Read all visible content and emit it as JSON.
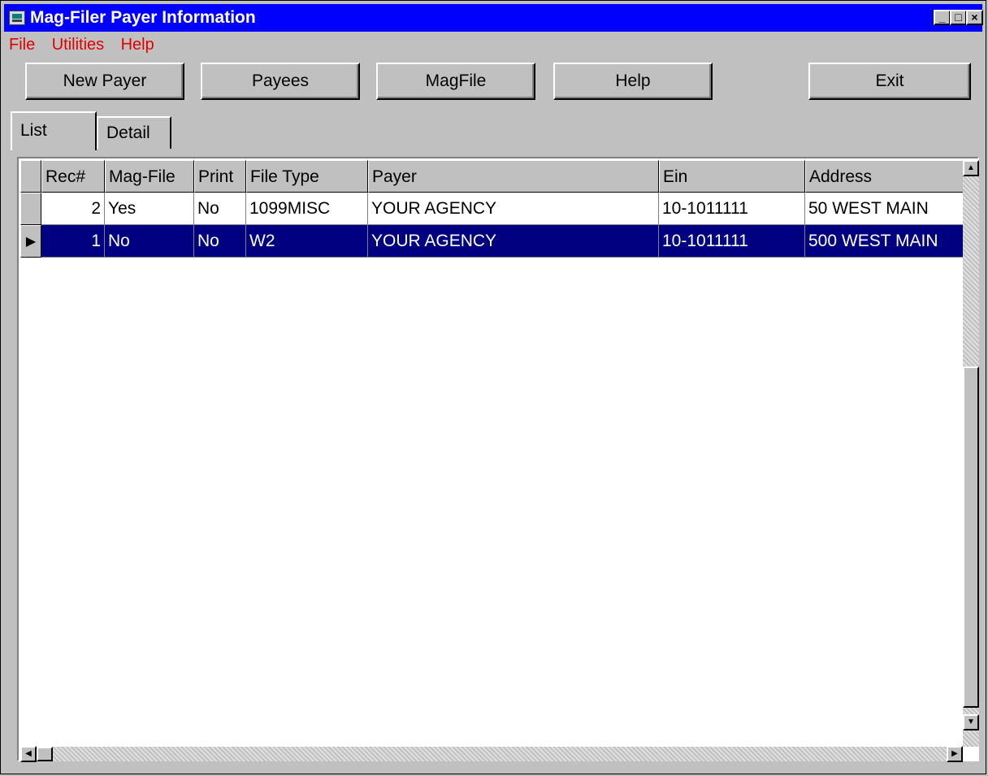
{
  "window": {
    "title": "Mag-Filer Payer Information"
  },
  "titlebar_buttons": {
    "minimize": "_",
    "maximize": "□",
    "close": "×"
  },
  "menu": [
    {
      "label": "File"
    },
    {
      "label": "Utilities"
    },
    {
      "label": "Help"
    }
  ],
  "toolbar": {
    "new_payer": "New Payer",
    "payees": "Payees",
    "magfile": "MagFile",
    "help": "Help",
    "exit": "Exit"
  },
  "tabs": [
    {
      "label": "List",
      "active": true
    },
    {
      "label": "Detail",
      "active": false
    }
  ],
  "grid": {
    "columns": [
      "Rec#",
      "Mag-File",
      "Print",
      "File Type",
      "Payer",
      "Ein",
      "Address"
    ],
    "rows": [
      {
        "rec": "2",
        "magfile": "Yes",
        "print": "No",
        "file_type": "1099MISC",
        "payer": "YOUR AGENCY",
        "ein": "10-1011111",
        "address": "50 WEST MAIN",
        "selected": false
      },
      {
        "rec": "1",
        "magfile": "No",
        "print": "No",
        "file_type": "W2",
        "payer": "YOUR AGENCY",
        "ein": "10-1011111",
        "address": "500 WEST MAIN",
        "selected": true
      }
    ]
  },
  "colors": {
    "titlebar": "#0000fe",
    "selection": "#000080",
    "menu_text": "#e00000"
  },
  "icons": {
    "app": "app-icon",
    "row_pointer": "triangle-right-icon"
  }
}
